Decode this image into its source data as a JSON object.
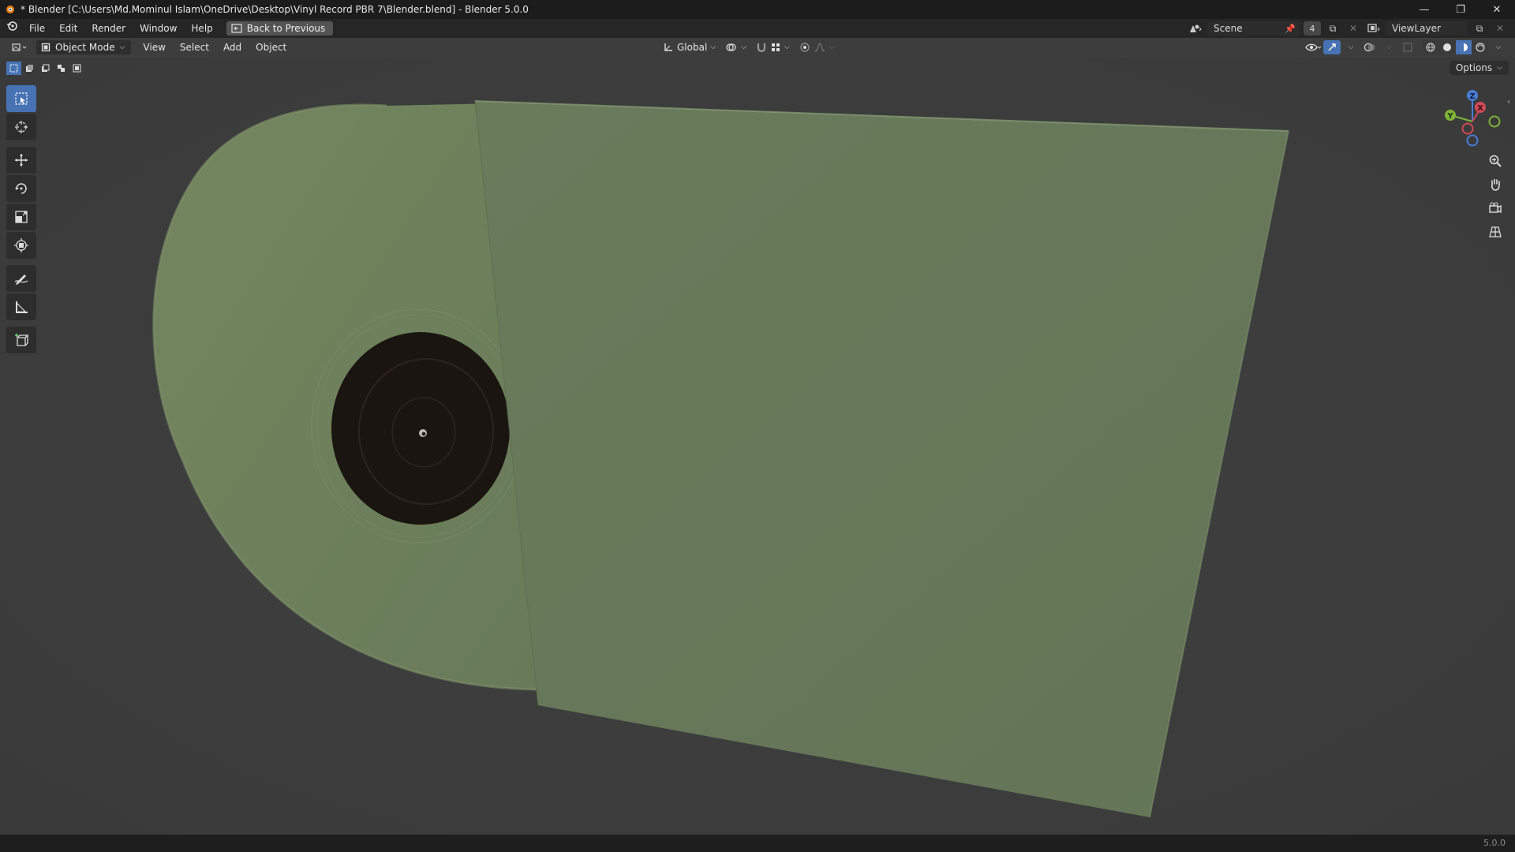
{
  "window": {
    "title": "* Blender [C:\\Users\\Md.Mominul Islam\\OneDrive\\Desktop\\Vinyl Record PBR 7\\Blender.blend] - Blender 5.0.0",
    "minimize_icon": "minimize-icon",
    "maximize_icon": "restore-icon",
    "close_icon": "close-icon"
  },
  "menu": {
    "items": [
      "File",
      "Edit",
      "Render",
      "Window",
      "Help"
    ],
    "back_button": "Back to Previous"
  },
  "top_right": {
    "scene_label": "Scene",
    "users_count": "4",
    "view_layer_label": "ViewLayer"
  },
  "viewport_header": {
    "mode": "Object Mode",
    "menus": [
      "View",
      "Select",
      "Add",
      "Object"
    ],
    "transform_orientation": "Global",
    "shading_active": "solid",
    "options_label": "Options"
  },
  "toolbar": {
    "tools": [
      "select-box",
      "cursor",
      "move",
      "rotate",
      "scale",
      "transform",
      "annotate",
      "measure",
      "add-cube"
    ],
    "active_tool": "select-box"
  },
  "scene_colors": {
    "background": "#3d3d3d",
    "record_color": "#6b7d59",
    "sleeve_color": "#66775a",
    "label_color": "#1b1511"
  },
  "gizmo": {
    "axes": [
      "Z",
      "Y",
      "X"
    ]
  },
  "status": {
    "version": "5.0.0"
  }
}
